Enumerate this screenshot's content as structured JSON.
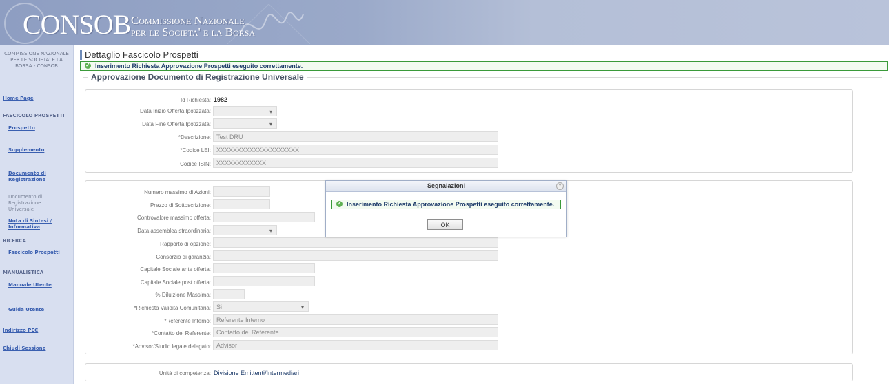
{
  "banner": {
    "brand": "CONSOB",
    "fullname_line1": "Commissione Nazionale",
    "fullname_line2": "per le Societa' e la Borsa"
  },
  "sidebar": {
    "org": "COMMISSIONE NAZIONALE PER LE SOCIETA' E LA BORSA - CONSOB",
    "home": "Home Page",
    "section_fascicolo": "FASCICOLO PROSPETTI",
    "prospetto": "Prospetto",
    "supplemento": "Supplemento",
    "documento_registrazione": "Documento di Registrazione",
    "documento_registrazione_universale": "Documento di Registrazione Universale",
    "nota_sintesi": "Nota di Sintesi / Informativa",
    "section_ricerca": "RICERCA",
    "fascicolo_prospetti": "Fascicolo Prospetti",
    "section_manualistica": "MANUALISTICA",
    "manuale_utente": "Manuale Utente",
    "guida_utente": "Guida Utente",
    "indirizzo_pec": "Indirizzo PEC",
    "chiudi_sessione": "Chiudi Sessione"
  },
  "page": {
    "title": "Dettaglio Fascicolo Prospetti",
    "success_message": "Inserimento Richiesta Approvazione Prospetti eseguito correttamente.",
    "section_title": "Approvazione Documento di Registrazione Universale"
  },
  "form1": {
    "id_label": "Id Richiesta:",
    "id_value": "1982",
    "data_inizio_label": "Data Inizio Offerta Ipotizzata:",
    "data_fine_label": "Data Fine Offerta Ipotizzata:",
    "descrizione_label": "*Descrizione:",
    "descrizione_value": "Test DRU",
    "lei_label": "*Codice LEI:",
    "lei_value": "XXXXXXXXXXXXXXXXXXXX",
    "isin_label": "Codice ISIN:",
    "isin_value": "XXXXXXXXXXXX"
  },
  "form2": {
    "numero_azioni_label": "Numero massimo di Azioni:",
    "prezzo_label": "Prezzo di Sottoscrizione:",
    "controvalore_label": "Controvalore massimo offerta:",
    "assemblea_label": "Data assemblea straordinaria:",
    "rapporto_label": "Rapporto di opzione:",
    "consorzio_label": "Consorzio di garanzia:",
    "capitale_ante_label": "Capitale Sociale ante offerta:",
    "capitale_post_label": "Capitale Sociale post offerta:",
    "diluizione_label": "% Diluizione Massima:",
    "validita_label": "*Richiesta Validità Comunitaria:",
    "validita_value": "Si",
    "referente_label": "*Referente Interno:",
    "referente_value": "Referente Interno",
    "contatto_label": "*Contatto del Referente:",
    "contatto_value": "Contatto del Referente",
    "advisor_label": "*Advisor/Studio legale delegato:",
    "advisor_value": "Advisor"
  },
  "form3": {
    "unita_label": "Unità di competenza:",
    "unita_value": "Divisione Emittenti/Intermediari"
  },
  "dialog": {
    "title": "Segnalazioni",
    "message": "Inserimento Richiesta Approvazione Prospetti eseguito correttamente.",
    "ok": "OK"
  }
}
